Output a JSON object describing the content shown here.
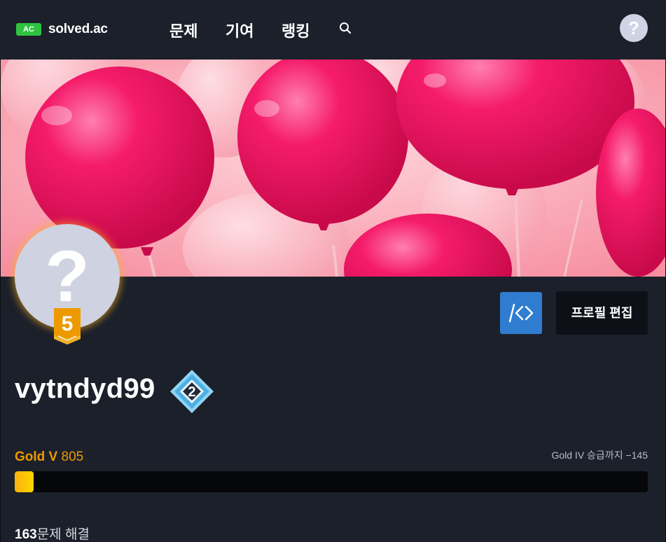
{
  "navbar": {
    "logo_badge": "AC",
    "logo_text": "solved.ac",
    "items": [
      {
        "label": "문제"
      },
      {
        "label": "기여"
      },
      {
        "label": "랭킹"
      }
    ],
    "search_icon": "search-icon",
    "help_label": "?"
  },
  "profile": {
    "avatar_placeholder": "?",
    "tier_badge_number": "5",
    "username": "vytndyd99",
    "class_badge_number": "2",
    "code_button_icon": "code-icon",
    "edit_button_label": "프로필 편집"
  },
  "rating": {
    "tier": "Gold V",
    "value": "805",
    "next_tier_text": "Gold IV 승급까지 −145",
    "progress_fraction": 0.03
  },
  "stats": {
    "solved_count": "163",
    "solved_suffix": "문제 해결"
  },
  "colors": {
    "background": "#1b202b",
    "logo_green": "#2fc33f",
    "gold": "#ec9a00",
    "code_button": "#2f7dd0",
    "banner_pink": "#f0145a"
  }
}
